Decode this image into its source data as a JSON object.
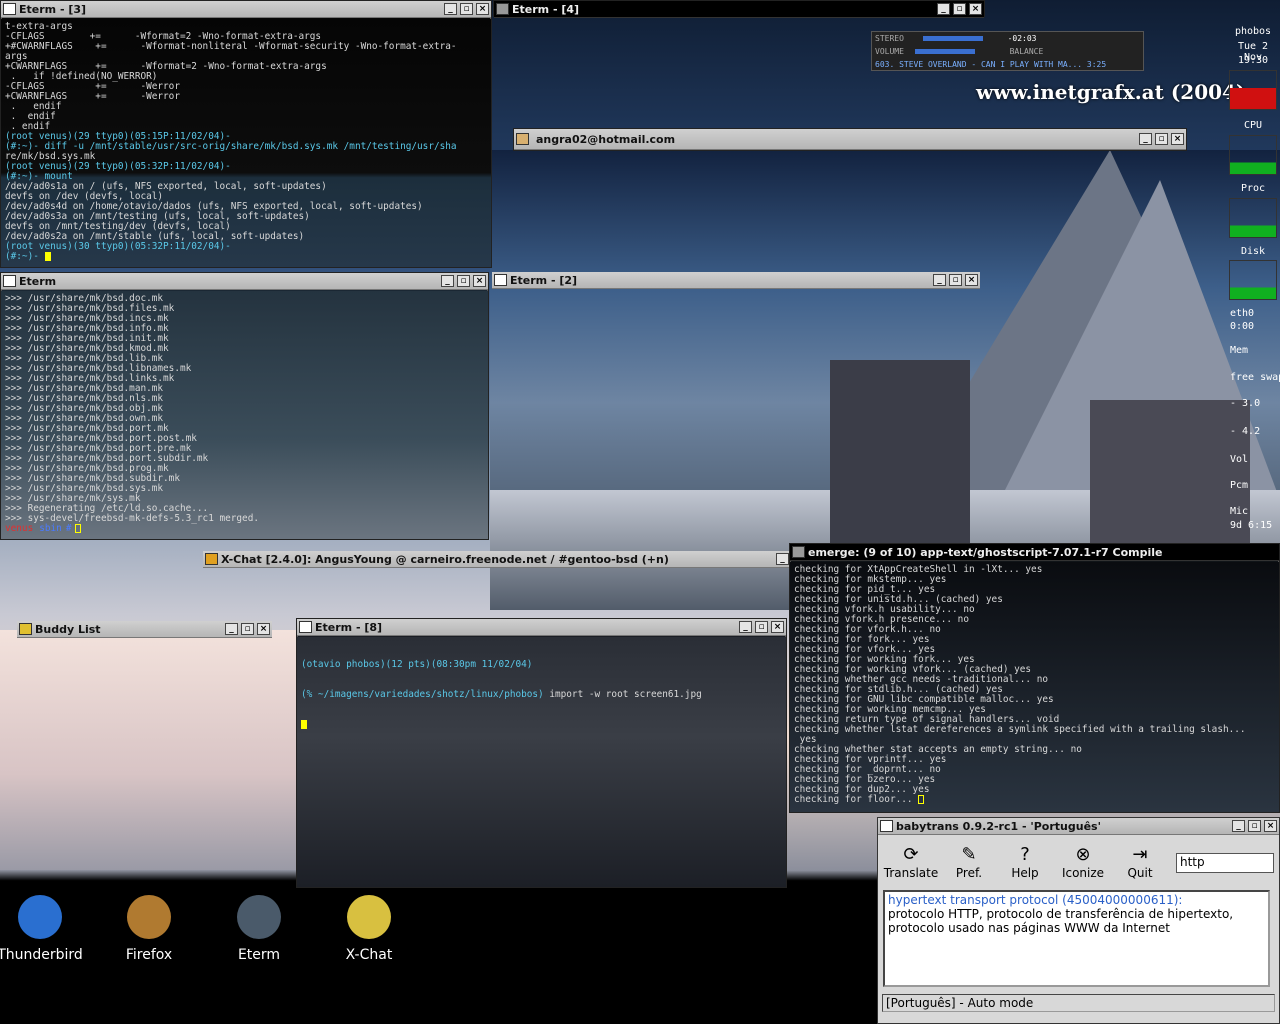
{
  "eterm3": {
    "title": "Eterm - [3]",
    "lines": [
      "t-extra-args",
      "-CFLAGS        +=      -Wformat=2 -Wno-format-extra-args",
      "+#CWARNFLAGS    +=      -Wformat-nonliteral -Wformat-security -Wno-format-extra-",
      "args",
      "+CWARNFLAGS     +=      -Wformat=2 -Wno-format-extra-args",
      " .   if !defined(NO_WERROR)",
      "-CFLAGS         +=      -Werror",
      "+CWARNFLAGS     +=      -Werror",
      " .   endif",
      " .  endif",
      " . endif",
      "(root venus)(29 ttyp0)(05:15P:11/02/04)-",
      "(#:~)- diff -u /mnt/stable/usr/src-orig/share/mk/bsd.sys.mk /mnt/testing/usr/sha",
      "re/mk/bsd.sys.mk",
      "(root venus)(29 ttyp0)(05:32P:11/02/04)-",
      "(#:~)- mount",
      "/dev/ad0s1a on / (ufs, NFS exported, local, soft-updates)",
      "devfs on /dev (devfs, local)",
      "/dev/ad0s4d on /home/otavio/dados (ufs, NFS exported, local, soft-updates)",
      "/dev/ad0s3a on /mnt/testing (ufs, local, soft-updates)",
      "devfs on /mnt/testing/dev (devfs, local)",
      "/dev/ad0s2a on /mnt/stable (ufs, local, soft-updates)",
      "(root venus)(30 ttyp0)(05:32P:11/02/04)-",
      "(#:~)- "
    ]
  },
  "eterm4": {
    "title": "Eterm - [4]"
  },
  "xmms": {
    "mode": "STEREO",
    "time": "-02:03",
    "volume_label": "VOLUME",
    "balance_label": "BALANCE",
    "song": "603. STEVE OVERLAND - CAN I PLAY WITH MA... 3:25"
  },
  "conky": {
    "host": "phobos",
    "date": "Tue 2 Nov",
    "time": "19:30",
    "cpu": "CPU",
    "proc": "Proc",
    "disk": "Disk",
    "eth0": "eth0",
    "eth0_val": "0:00",
    "mem": "Mem",
    "free_swap": "free swap",
    "v1": "- 3.0",
    "v2": "- 4.2",
    "vol": "Vol",
    "pcm": "Pcm",
    "mic": "Mic",
    "uptime": "9d 6:15"
  },
  "site": "www.inetgrafx.at (2004)",
  "msn": {
    "title": "angra02@hotmail.com"
  },
  "eterm_main": {
    "title": "Eterm",
    "lines": [
      ">>> /usr/share/mk/bsd.doc.mk",
      ">>> /usr/share/mk/bsd.files.mk",
      ">>> /usr/share/mk/bsd.incs.mk",
      ">>> /usr/share/mk/bsd.info.mk",
      ">>> /usr/share/mk/bsd.init.mk",
      ">>> /usr/share/mk/bsd.kmod.mk",
      ">>> /usr/share/mk/bsd.lib.mk",
      ">>> /usr/share/mk/bsd.libnames.mk",
      ">>> /usr/share/mk/bsd.links.mk",
      ">>> /usr/share/mk/bsd.man.mk",
      ">>> /usr/share/mk/bsd.nls.mk",
      ">>> /usr/share/mk/bsd.obj.mk",
      ">>> /usr/share/mk/bsd.own.mk",
      ">>> /usr/share/mk/bsd.port.mk",
      ">>> /usr/share/mk/bsd.port.post.mk",
      ">>> /usr/share/mk/bsd.port.pre.mk",
      ">>> /usr/share/mk/bsd.port.subdir.mk",
      ">>> /usr/share/mk/bsd.prog.mk",
      ">>> /usr/share/mk/bsd.subdir.mk",
      ">>> /usr/share/mk/bsd.sys.mk",
      ">>> /usr/share/mk/sys.mk",
      ">>> Regenerating /etc/ld.so.cache...",
      ">>> sys-devel/freebsd-mk-defs-5.3_rc1 merged."
    ],
    "prompt_host": "venus",
    "prompt_dir": "sbin",
    "prompt_char": "#"
  },
  "eterm2": {
    "title": "Eterm - [2]"
  },
  "xchat": {
    "title": "X-Chat [2.4.0]: AngusYoung @ carneiro.freenode.net / #gentoo-bsd (+n)"
  },
  "buddy": {
    "title": "Buddy List"
  },
  "eterm8": {
    "title": "Eterm - [8]",
    "line1": "(otavio phobos)(12 pts)(08:30pm 11/02/04)",
    "line2_path": "(% ~/imagens/variedades/shotz/linux/phobos)",
    "line2_cmd": " import -w root screen61.jpg"
  },
  "emerge": {
    "title": "emerge: (9 of 10) app-text/ghostscript-7.07.1-r7 Compile",
    "lines": [
      "checking for XtAppCreateShell in -lXt... yes",
      "checking for mkstemp... yes",
      "checking for pid_t... yes",
      "checking for unistd.h... (cached) yes",
      "checking vfork.h usability... no",
      "checking vfork.h presence... no",
      "checking for vfork.h... no",
      "checking for fork... yes",
      "checking for vfork... yes",
      "checking for working fork... yes",
      "checking for working vfork... (cached) yes",
      "checking whether gcc needs -traditional... no",
      "checking for stdlib.h... (cached) yes",
      "checking for GNU libc compatible malloc... yes",
      "checking for working memcmp... yes",
      "checking return type of signal handlers... void",
      "checking whether lstat dereferences a symlink specified with a trailing slash...",
      " yes",
      "checking whether stat accepts an empty string... no",
      "checking for vprintf... yes",
      "checking for _doprnt... no",
      "checking for bzero... yes",
      "checking for dup2... yes",
      "checking for floor... "
    ]
  },
  "desktop_icons": [
    {
      "label": "Thunderbird",
      "color": "#2a6fd0"
    },
    {
      "label": "Firefox",
      "color": "#b07a30"
    },
    {
      "label": "Eterm",
      "color": "#4a5a6a"
    },
    {
      "label": "X-Chat",
      "color": "#d8c040"
    }
  ],
  "babytrans": {
    "title": "babytrans 0.9.2-rc1 - 'Português'",
    "tools": [
      {
        "label": "Translate",
        "glyph": "⟳"
      },
      {
        "label": "Pref.",
        "glyph": "✎"
      },
      {
        "label": "Help",
        "glyph": "?"
      },
      {
        "label": "Iconize",
        "glyph": "⊗"
      },
      {
        "label": "Quit",
        "glyph": "⇥"
      }
    ],
    "input": "http",
    "result_head": "hypertext transport protocol (45004000000611):",
    "result_body1": "protocolo HTTP, protocolo de transferência de hipertexto,",
    "result_body2": "protocolo usado nas páginas WWW da Internet",
    "status": "[Português] - Auto mode"
  }
}
